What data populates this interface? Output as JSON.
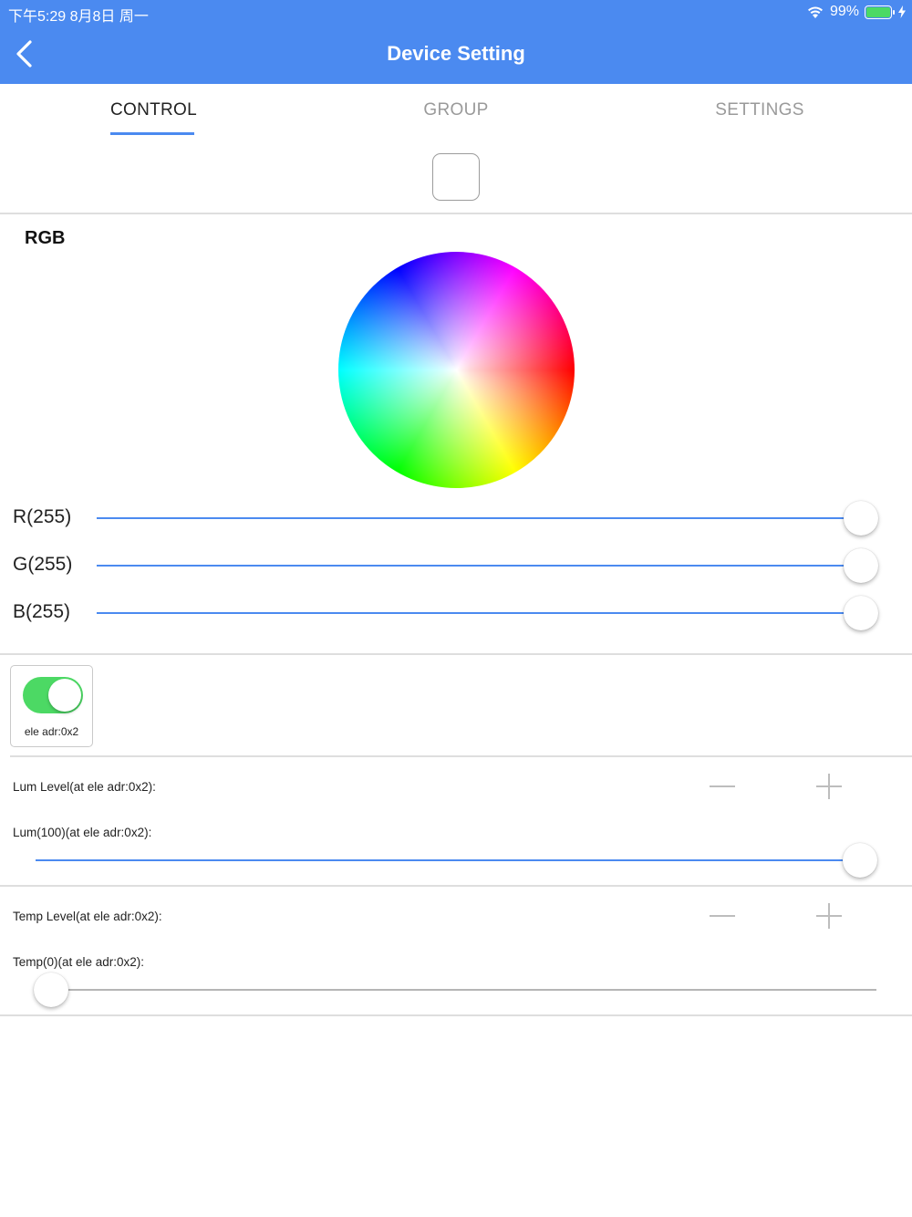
{
  "status_bar": {
    "time": "下午5:29   8月8日 周一",
    "battery": "99%",
    "battery_level": 0.99,
    "icons": [
      "wifi-icon",
      "battery-icon",
      "charging-icon"
    ]
  },
  "nav": {
    "title": "Device Setting",
    "back_icon": "chevron-left-icon"
  },
  "tabs": [
    {
      "label": "CONTROL",
      "active": true
    },
    {
      "label": "GROUP",
      "active": false
    },
    {
      "label": "SETTINGS",
      "active": false
    }
  ],
  "rgb": {
    "title": "RGB",
    "sliders": [
      {
        "label": "R(255)",
        "value": 255,
        "max": 255
      },
      {
        "label": "G(255)",
        "value": 255,
        "max": 255
      },
      {
        "label": "B(255)",
        "value": 255,
        "max": 255
      }
    ]
  },
  "element": {
    "label": "ele adr:0x2",
    "on": true
  },
  "lum": {
    "level_label": "Lum Level(at ele adr:0x2):",
    "value_label": "Lum(100)(at ele adr:0x2):",
    "value": 100,
    "max": 100
  },
  "temp": {
    "level_label": "Temp Level(at ele adr:0x2):",
    "value_label": "Temp(0)(at ele adr:0x2):",
    "value": 0,
    "max": 100
  },
  "colors": {
    "accent": "#4b8af0",
    "toggle_on": "#4cd964",
    "track_inactive": "#b5b5b5",
    "control_gray": "#bdbdbd"
  }
}
